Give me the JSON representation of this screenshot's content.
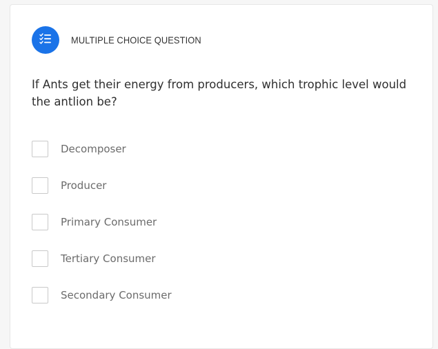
{
  "question": {
    "type_label": "MULTIPLE CHOICE QUESTION",
    "type_icon": "checklist-icon",
    "text": "If Ants get their energy from producers, which trophic level would the antlion be?",
    "options": [
      {
        "label": "Decomposer",
        "checked": false
      },
      {
        "label": "Producer",
        "checked": false
      },
      {
        "label": "Primary Consumer",
        "checked": false
      },
      {
        "label": "Tertiary Consumer",
        "checked": false
      },
      {
        "label": "Secondary Consumer",
        "checked": false
      }
    ]
  },
  "colors": {
    "accent": "#1a73e8",
    "checkbox_border": "#c9c9c9",
    "option_text": "#6b6b6b"
  }
}
